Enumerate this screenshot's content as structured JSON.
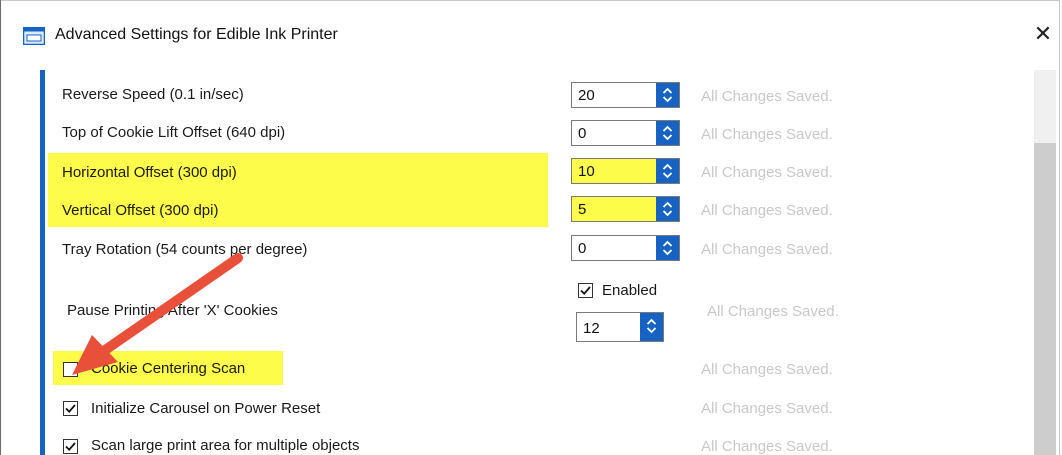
{
  "window": {
    "title": "Advanced Settings for Edible Ink Printer",
    "close_glyph": "✕",
    "icon": "printer-icon"
  },
  "settings": [
    {
      "label": "Reverse Speed (0.1 in/sec)",
      "value": "20",
      "status": "All Changes Saved.",
      "highlighted": false
    },
    {
      "label": "Top of Cookie Lift Offset (640 dpi)",
      "value": "0",
      "status": "All Changes Saved.",
      "highlighted": false
    },
    {
      "label": "Horizontal Offset (300 dpi)",
      "value": "10",
      "status": "All Changes Saved.",
      "highlighted": true
    },
    {
      "label": "Vertical Offset (300 dpi)",
      "value": "5",
      "status": "All Changes Saved.",
      "highlighted": true
    },
    {
      "label": "Tray Rotation (54 counts per degree)",
      "value": "0",
      "status": "All Changes Saved.",
      "highlighted": false
    }
  ],
  "pause": {
    "label": "Pause Printing After 'X' Cookies",
    "enabled_label": "Enabled",
    "enabled_checked": true,
    "value": "12",
    "status": "All Changes Saved."
  },
  "checkboxes": [
    {
      "label": "Cookie Centering Scan",
      "checked": false,
      "status": "All Changes Saved.",
      "highlighted": true
    },
    {
      "label": "Initialize Carousel on Power Reset",
      "checked": true,
      "status": "All Changes Saved.",
      "highlighted": false
    },
    {
      "label": "Scan large print area for multiple objects",
      "checked": true,
      "status": "All Changes Saved.",
      "highlighted": false
    }
  ],
  "colors": {
    "accent": "#1763c4",
    "highlight": "#fdfc4a",
    "annotation_arrow": "#e8503a",
    "status_text": "#c8c8c8"
  }
}
